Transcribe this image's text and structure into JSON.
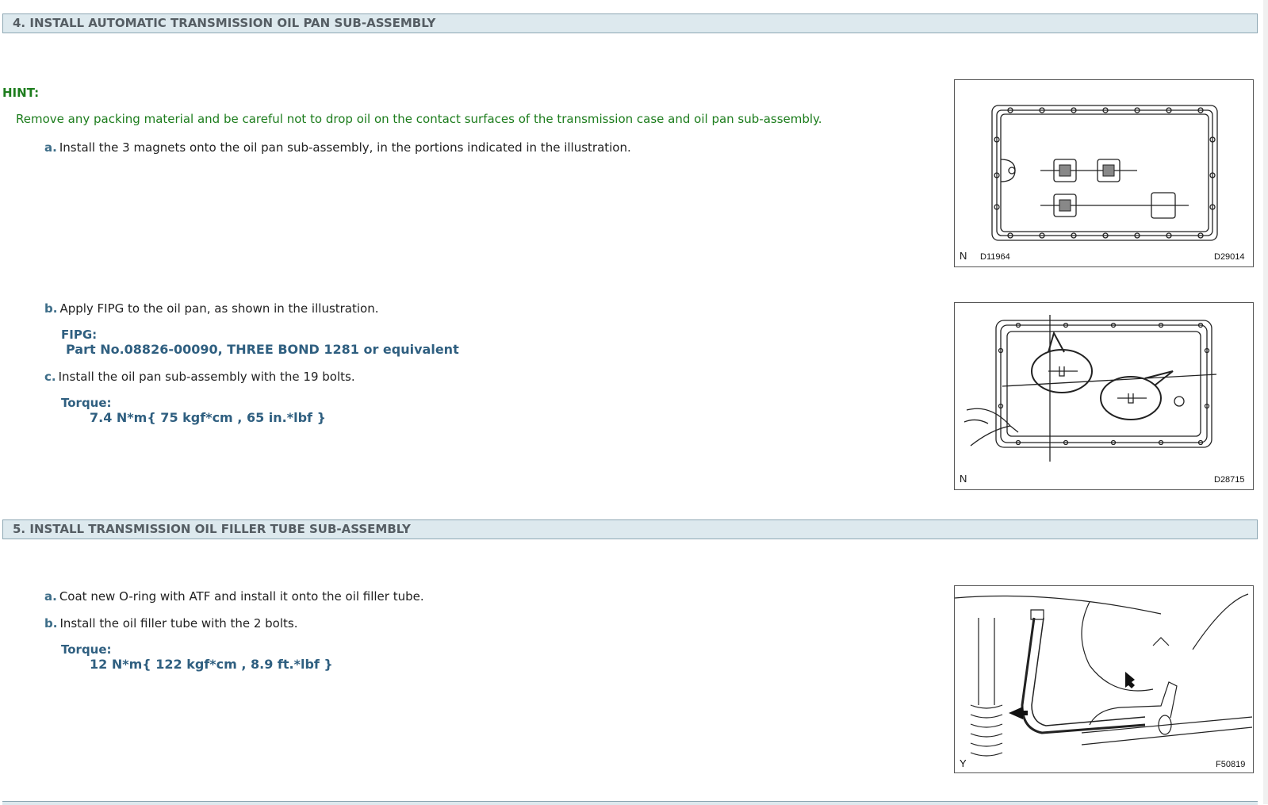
{
  "section4": {
    "title": "4. INSTALL AUTOMATIC TRANSMISSION OIL PAN SUB-ASSEMBLY",
    "hint_label": "HINT:",
    "hint_text": "Remove any packing material and be careful not to drop oil on the contact surfaces of the transmission case and oil pan sub-assembly.",
    "step_a": {
      "letter": "a.",
      "text": "Install the 3 magnets onto the oil pan sub-assembly, in the portions indicated in the illustration."
    },
    "step_b": {
      "letter": "b.",
      "text": "Apply FIPG to the oil pan, as shown in the illustration."
    },
    "fipg_label": "FIPG:",
    "fipg_value": "Part No.08826-00090, THREE BOND 1281 or equivalent",
    "step_c": {
      "letter": "c.",
      "text": "Install the oil pan sub-assembly with the 19 bolts."
    },
    "torque_label": "Torque:",
    "torque_value": "7.4 N*m{ 75 kgf*cm , 65 in.*lbf }",
    "figure1": {
      "corner": "N",
      "code_left": "D11964",
      "code_right": "D29014"
    },
    "figure2": {
      "corner": "N",
      "code_right": "D28715"
    }
  },
  "section5": {
    "title": "5. INSTALL TRANSMISSION OIL FILLER TUBE SUB-ASSEMBLY",
    "step_a": {
      "letter": "a.",
      "text": "Coat new O-ring with ATF and install it onto the oil filler tube."
    },
    "step_b": {
      "letter": "b.",
      "text": "Install the oil filler tube with the 2 bolts."
    },
    "torque_label": "Torque:",
    "torque_value": "12 N*m{ 122 kgf*cm , 8.9 ft.*lbf }",
    "figure3": {
      "corner": "Y",
      "code_right": "F50819"
    }
  }
}
